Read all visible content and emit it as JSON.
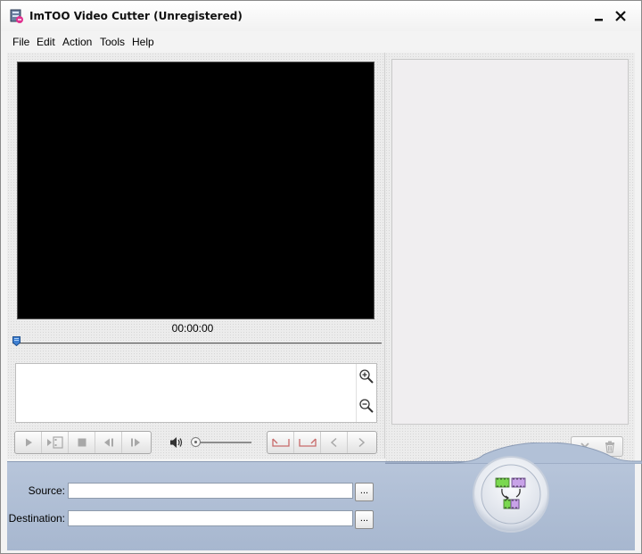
{
  "window": {
    "title": "ImTOO Video Cutter (Unregistered)",
    "app_icon": "video-cutter-app-icon"
  },
  "title_buttons": {
    "minimize": "minimize-icon",
    "close": "close-icon"
  },
  "menu": {
    "items": [
      "File",
      "Edit",
      "Action",
      "Tools",
      "Help"
    ]
  },
  "player": {
    "timecode": "00:00:00",
    "seek_position": 0
  },
  "timeline": {
    "zoom_in_icon": "zoom-in-icon",
    "zoom_out_icon": "zoom-out-icon"
  },
  "transport": {
    "buttons": [
      "play-icon",
      "next-frame-icon",
      "stop-icon",
      "prev-frame-icon",
      "step-forward-icon"
    ],
    "volume_icon": "speaker-icon",
    "volume_level": 0
  },
  "marks": {
    "buttons": [
      "set-start-mark-icon",
      "set-end-mark-icon",
      "go-to-start-mark-icon",
      "go-to-end-mark-icon"
    ]
  },
  "list_actions": {
    "remove_icon": "remove-icon",
    "delete_icon": "trash-icon"
  },
  "bottom": {
    "source_label": "Source:",
    "source_value": "",
    "destination_label": "Destination:",
    "destination_value": "",
    "browse_label": "...",
    "convert_icon": "convert-icon"
  },
  "colors": {
    "bottom_bar": "#a9b9d1",
    "video_bg": "#000000",
    "seek_thumb": "#3e7fd1"
  }
}
